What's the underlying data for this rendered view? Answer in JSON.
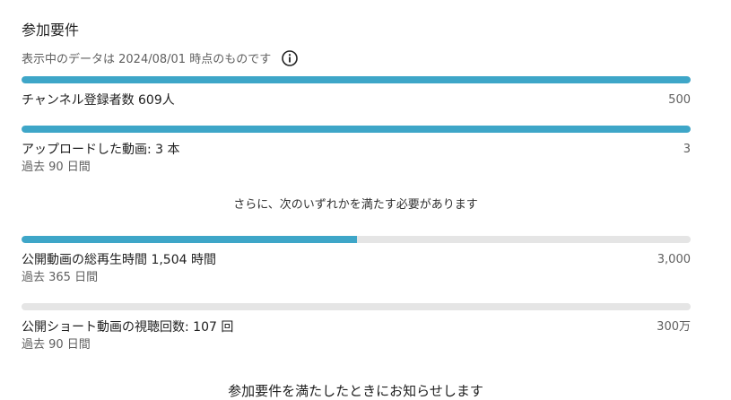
{
  "title": "参加要件",
  "subtitle": "表示中のデータは 2024/08/01 時点のものです",
  "info_icon": "info-circle-icon",
  "colors": {
    "progress_fill": "#3ea6c8",
    "progress_track": "#e5e5e5"
  },
  "requirements_primary": [
    {
      "label": "チャンネル登録者数 609人",
      "target": "500",
      "period": "",
      "progress": 1.0
    },
    {
      "label": "アップロードした動画: 3 本",
      "target": "3",
      "period": "過去 90 日間",
      "progress": 1.0
    }
  ],
  "middle_note": "さらに、次のいずれかを満たす必要があります",
  "requirements_either": [
    {
      "label": "公開動画の総再生時間 1,504 時間",
      "target": "3,000",
      "period": "過去 365 日間",
      "progress": 0.501
    },
    {
      "label": "公開ショート動画の視聴回数: 107 回",
      "target": "300万",
      "period": "過去 90 日間",
      "progress": 0.0
    }
  ],
  "footer_note": "参加要件を満たしたときにお知らせします"
}
